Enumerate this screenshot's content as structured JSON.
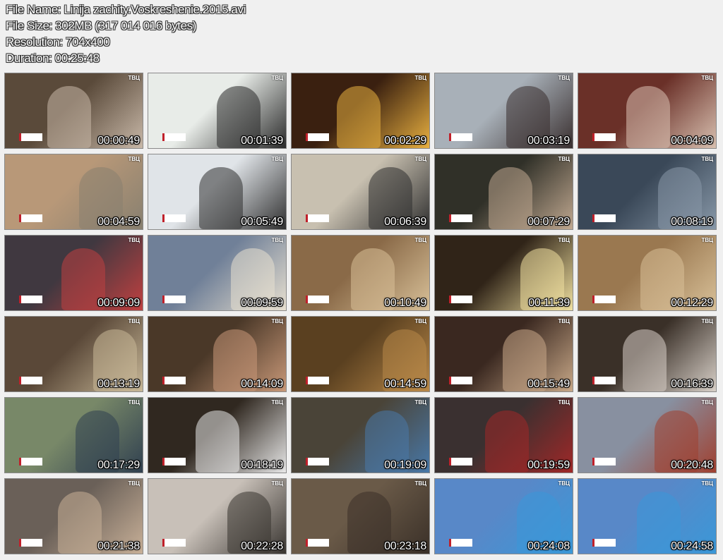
{
  "header": {
    "file_name": "File Name: Linija zachity.Voskreshenie.2015.avi",
    "file_size": "File Size: 302MB (317 014 016 bytes)",
    "resolution": "Resolution: 704x400",
    "duration": "Duration: 00:25:48"
  },
  "thumbnails": [
    {
      "time": "00:00:49",
      "bg": "#5a4a3a",
      "accent": "#c8b8a8"
    },
    {
      "time": "00:01:39",
      "bg": "#e8ece8",
      "accent": "#2a2a2a"
    },
    {
      "time": "00:02:29",
      "bg": "#3a2010",
      "accent": "#e8b040"
    },
    {
      "time": "00:03:19",
      "bg": "#a8b0b8",
      "accent": "#3a3030"
    },
    {
      "time": "00:04:09",
      "bg": "#6a3028",
      "accent": "#d8c0b0"
    },
    {
      "time": "00:04:59",
      "bg": "#b89878",
      "accent": "#888070"
    },
    {
      "time": "00:05:49",
      "bg": "#e0e4e8",
      "accent": "#303030"
    },
    {
      "time": "00:06:39",
      "bg": "#c8c0b0",
      "accent": "#303030"
    },
    {
      "time": "00:07:29",
      "bg": "#303028",
      "accent": "#c0a890"
    },
    {
      "time": "00:08:19",
      "bg": "#3a4858",
      "accent": "#8898a8"
    },
    {
      "time": "00:09:09",
      "bg": "#403840",
      "accent": "#c04040"
    },
    {
      "time": "00:09:59",
      "bg": "#708098",
      "accent": "#e8e0d0"
    },
    {
      "time": "00:10:49",
      "bg": "#8a6a48",
      "accent": "#d8c098"
    },
    {
      "time": "00:11:39",
      "bg": "#302418",
      "accent": "#f0e0a0"
    },
    {
      "time": "00:12:29",
      "bg": "#9a7850",
      "accent": "#d8c098"
    },
    {
      "time": "00:13:19",
      "bg": "#5a4838",
      "accent": "#c8b898"
    },
    {
      "time": "00:14:09",
      "bg": "#4a3828",
      "accent": "#c89878"
    },
    {
      "time": "00:14:59",
      "bg": "#5a4020",
      "accent": "#b88848"
    },
    {
      "time": "00:15:49",
      "bg": "#3a2820",
      "accent": "#c8a888"
    },
    {
      "time": "00:16:39",
      "bg": "#3a3028",
      "accent": "#d8d0c8"
    },
    {
      "time": "00:17:29",
      "bg": "#788868",
      "accent": "#304050"
    },
    {
      "time": "00:18:19",
      "bg": "#302820",
      "accent": "#e8e8e8"
    },
    {
      "time": "00:19:09",
      "bg": "#4a4438",
      "accent": "#4878a8"
    },
    {
      "time": "00:19:59",
      "bg": "#3a3030",
      "accent": "#a02828"
    },
    {
      "time": "00:20:48",
      "bg": "#8890a0",
      "accent": "#a04030"
    },
    {
      "time": "00:21:38",
      "bg": "#6a6058",
      "accent": "#c8b098"
    },
    {
      "time": "00:22:28",
      "bg": "#c8c0b8",
      "accent": "#383430"
    },
    {
      "time": "00:23:18",
      "bg": "#6a5a48",
      "accent": "#3a3028"
    },
    {
      "time": "00:24:08",
      "bg": "#5888c8",
      "accent": "#3a98d8"
    },
    {
      "time": "00:24:58",
      "bg": "#5888c8",
      "accent": "#3a98d8"
    }
  ],
  "channel_label": "ТВЦ"
}
